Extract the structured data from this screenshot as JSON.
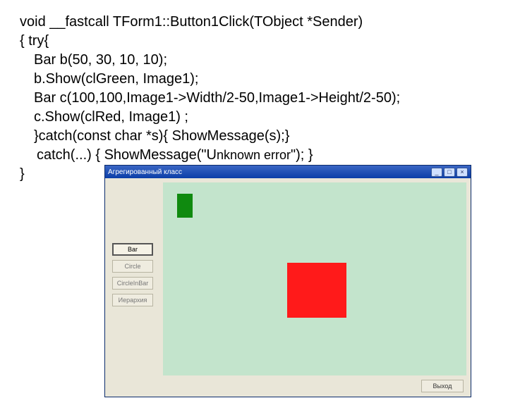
{
  "code": {
    "l1": "void __fastcall TForm1::Button1Click(TObject *Sender)",
    "l2": "{ try{",
    "l3": "Bar b(50, 30, 10, 10);",
    "l4": "b.Show(clGreen, Image1);",
    "l5": "Bar c(100,100,Image1->Width/2-50,Image1->Height/2-50);",
    "l6": "c.Show(clRed, Image1) ;",
    "l7": "}catch(const char *s){ ShowMessage(s);}",
    "l8a": "catch(...) { ShowMessage(\"U",
    "l8b": "nknown error",
    "l8c": "\"); }",
    "l9": "}"
  },
  "window": {
    "title": "Агрегированный класс",
    "min": "_",
    "max": "□",
    "close": "×",
    "buttons": {
      "b1": "Bar",
      "b2": "Circle",
      "b3": "CircleInBar",
      "b4": "Иерархия"
    },
    "exit": "Выход"
  }
}
